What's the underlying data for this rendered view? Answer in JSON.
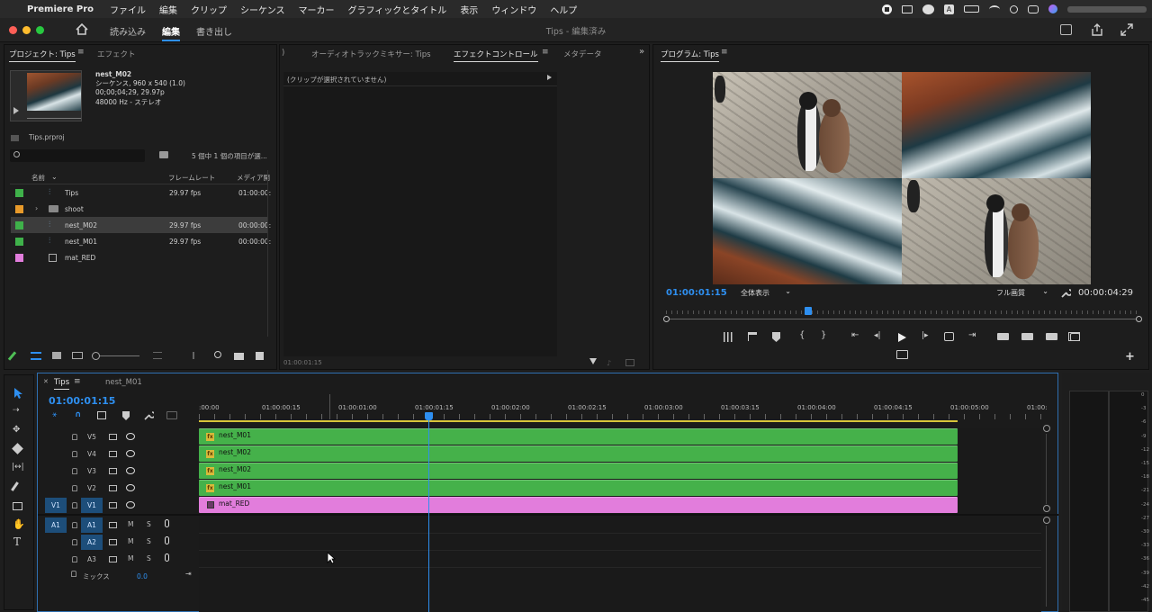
{
  "menubar": {
    "app": "Premiere Pro",
    "items": [
      "ファイル",
      "編集",
      "クリップ",
      "シーケンス",
      "マーカー",
      "グラフィックとタイトル",
      "表示",
      "ウィンドウ",
      "ヘルプ"
    ]
  },
  "titlebar": {
    "title": "Tips - 編集済み",
    "workspaces": [
      "読み込み",
      "編集",
      "書き出し"
    ],
    "active": "編集"
  },
  "project": {
    "tabs": [
      "プロジェクト: Tips",
      "エフェクト"
    ],
    "preview": {
      "name": "nest_M02",
      "info1": "シーケンス, 960 x 540 (1.0)",
      "info2": "00;00;04;29, 29.97p",
      "info3": "48000 Hz - ステレオ"
    },
    "file": "Tips.prproj",
    "selection": "5 個中 1 個の項目が選...",
    "columns": [
      "名前",
      "フレームレート",
      "メディア開"
    ],
    "items": [
      {
        "name": "Tips",
        "fps": "29.97 fps",
        "start": "01:00:00:",
        "color": "#3fb14a",
        "type": "sequence"
      },
      {
        "name": "shoot",
        "fps": "",
        "start": "",
        "color": "#e89a2a",
        "type": "folder"
      },
      {
        "name": "nest_M02",
        "fps": "29.97 fps",
        "start": "00:00:00:",
        "color": "#3fb14a",
        "type": "sequence"
      },
      {
        "name": "nest_M01",
        "fps": "29.97 fps",
        "start": "00:00:00:",
        "color": "#3fb14a",
        "type": "sequence"
      },
      {
        "name": "mat_RED",
        "fps": "",
        "start": "",
        "color": "#e27ddc",
        "type": "matte"
      }
    ]
  },
  "effects": {
    "tabs": [
      "オーディオトラックミキサー: Tips",
      "エフェクトコントロール",
      "メタデータ"
    ],
    "empty": "(クリップが選択されていません)",
    "timecode": "01:00:01:15"
  },
  "program": {
    "title": "プログラム: Tips",
    "timecode": "01:00:01:15",
    "fit": "全体表示",
    "quality": "フル画質",
    "duration": "00:00:04:29",
    "playhead_fraction": 0.3
  },
  "timeline": {
    "tabs": [
      "Tips",
      "nest_M01"
    ],
    "timecode": "01:00:01:15",
    "ruler": [
      ":00:00",
      "01:00:00:15",
      "01:00:01:00",
      "01:00:01:15",
      "01:00:02:00",
      "01:00:02:15",
      "01:00:03:00",
      "01:00:03:15",
      "01:00:04:00",
      "01:00:04:15",
      "01:00:05:00",
      "01:00:"
    ],
    "video_tracks": [
      {
        "name": "V5",
        "clip": "nest_M01"
      },
      {
        "name": "V4",
        "clip": "nest_M02"
      },
      {
        "name": "V3",
        "clip": "nest_M02"
      },
      {
        "name": "V2",
        "clip": "nest_M01"
      },
      {
        "name": "V1",
        "clip": "mat_RED"
      }
    ],
    "audio_tracks": [
      "A1",
      "A2",
      "A3"
    ],
    "src_v": "V1",
    "src_a": "A1",
    "mute": "M",
    "solo": "S",
    "mix_label": "ミックス",
    "mix_value": "0.0"
  },
  "meter": {
    "scale": [
      "0",
      "-3",
      "-6",
      "-9",
      "-12",
      "-15",
      "-18",
      "-21",
      "-24",
      "-27",
      "-30",
      "-33",
      "-36",
      "-39",
      "-42",
      "-45"
    ]
  },
  "colors": {
    "accent": "#2e8ff0",
    "clip_green": "#45b14a",
    "clip_pink": "#e27ddc"
  }
}
